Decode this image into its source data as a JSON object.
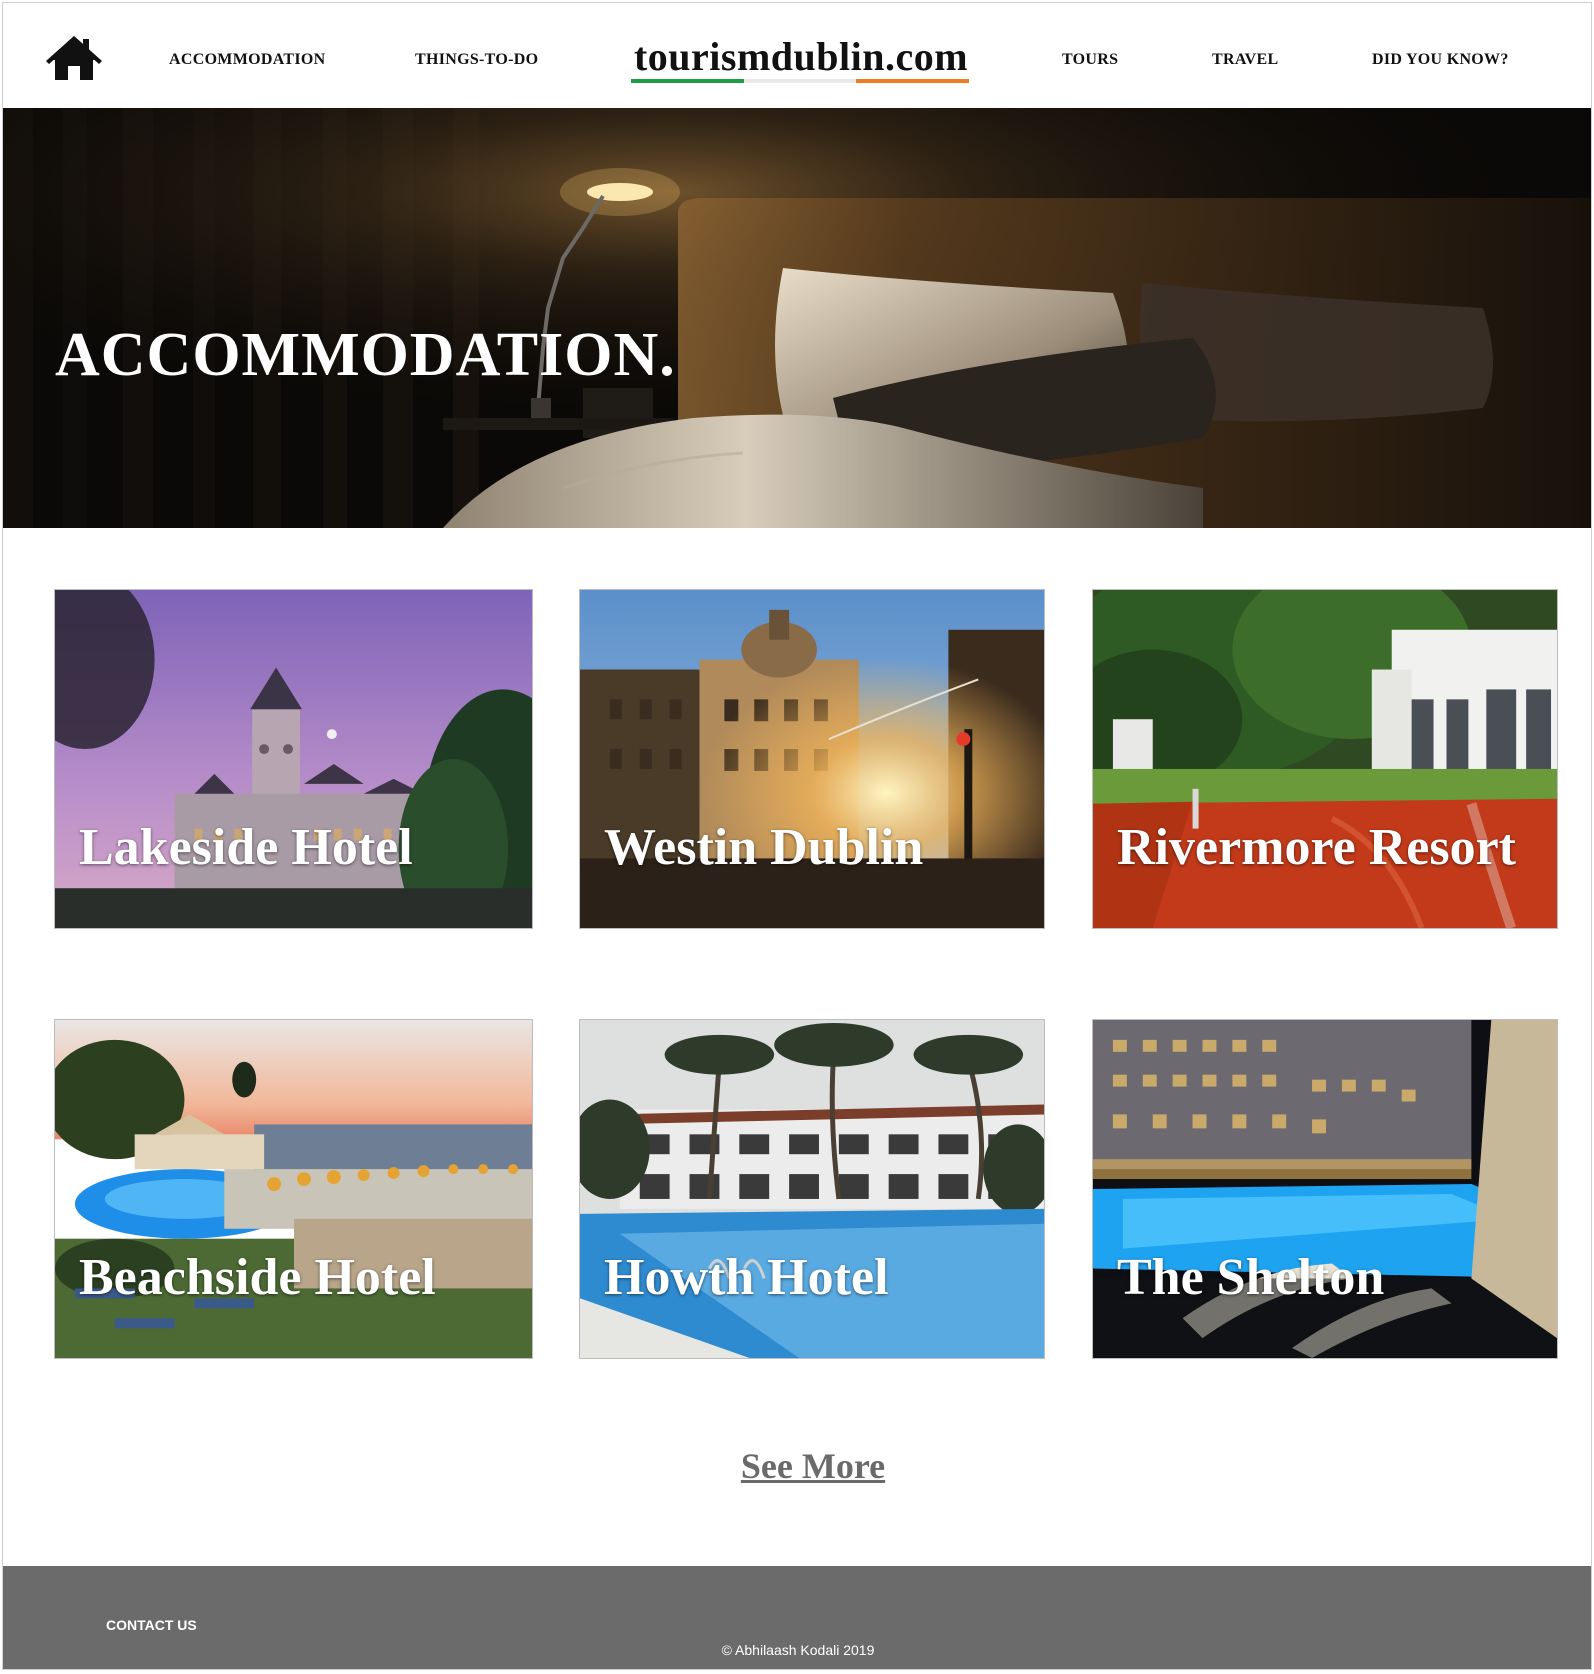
{
  "header": {
    "logo_text": "tourismdublin.com",
    "home_icon": "home-icon",
    "nav": {
      "accommodation": "ACCOMMODATION",
      "things_to_do": "THINGS-TO-DO",
      "tours": "TOURS",
      "travel": "TRAVEL",
      "did_you_know": "DID YOU KNOW?"
    },
    "logo_underline_colors": [
      "#1f9e46",
      "#ffffff",
      "#ef7b22"
    ]
  },
  "hero": {
    "title": "ACCOMMODATION."
  },
  "hotels": [
    {
      "name": "Lakeside Hotel"
    },
    {
      "name": "Westin Dublin"
    },
    {
      "name": "Rivermore Resort"
    },
    {
      "name": "Beachside Hotel"
    },
    {
      "name": "Howth Hotel"
    },
    {
      "name": "The Shelton"
    }
  ],
  "see_more": "See More",
  "footer": {
    "contact": "CONTACT US",
    "copyright": "© Abhilaash Kodali 2019",
    "background": "#6b6b6b"
  }
}
